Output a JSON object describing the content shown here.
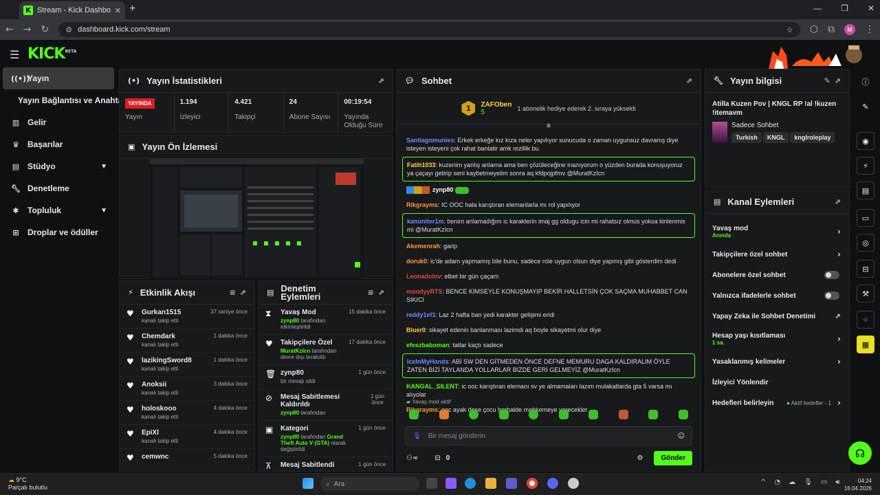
{
  "browser": {
    "tab_title": "Stream - Kick Dashboard",
    "tab_favicon": "K",
    "url": "dashboard.kick.com/stream",
    "profile_initial": "M"
  },
  "app": {
    "logo": "KICK",
    "logo_sup": "BETA"
  },
  "sidebar": {
    "items": [
      {
        "label": "Yayın",
        "icon": "broadcast-icon"
      },
      {
        "label": "Yayın Bağlantısı ve Anahtarı"
      },
      {
        "label": "Gelir",
        "icon": "chart-icon"
      },
      {
        "label": "Başarılar",
        "icon": "trophy-icon"
      },
      {
        "label": "Stüdyo",
        "icon": "studio-icon"
      },
      {
        "label": "Denetleme",
        "icon": "wrench-icon"
      },
      {
        "label": "Topluluk",
        "icon": "community-icon"
      },
      {
        "label": "Droplar ve ödüller",
        "icon": "gift-icon"
      }
    ]
  },
  "stats": {
    "title": "Yayın İstatistikleri",
    "live_badge": "YAYINDA",
    "cols": [
      {
        "value": "",
        "label": "Yayın"
      },
      {
        "value": "1.194",
        "label": "İzleyici"
      },
      {
        "value": "4.421",
        "label": "Takipçi"
      },
      {
        "value": "24",
        "label": "Abone Sayısı"
      },
      {
        "value": "00:19:54",
        "label": "Yayında Olduğu Süre"
      }
    ]
  },
  "preview": {
    "title": "Yayın Ön İzlemesi"
  },
  "activity": {
    "title": "Etkinlik Akışı",
    "items": [
      {
        "name": "Gurkan1515",
        "sub": "kanalı takip etti",
        "time": "37 saniye önce"
      },
      {
        "name": "Chemdark",
        "sub": "kanalı takip etti",
        "time": "1 dakika önce"
      },
      {
        "name": "lazikingSword8",
        "sub": "kanalı takip etti",
        "time": "1 dakika önce"
      },
      {
        "name": "Anoksii",
        "sub": "kanalı takip etti",
        "time": "3 dakika önce"
      },
      {
        "name": "holoskooo",
        "sub": "kanalı takip etti",
        "time": "4 dakika önce"
      },
      {
        "name": "EpiXl",
        "sub": "kanalı takip etti",
        "time": "4 dakika önce"
      },
      {
        "name": "cemwnc",
        "sub": "",
        "time": "5 dakika önce"
      }
    ]
  },
  "mods": {
    "title": "Denetim Eylemleri",
    "items": [
      {
        "name": "Yavaş Mod",
        "user": "zynp80",
        "sub": "tarafından etkinleştirildi",
        "time": "15 dakika önce"
      },
      {
        "name": "Takipçilere Özel",
        "user": "MuratKzIcn",
        "sub": "tarafından devre dışı bırakıldı",
        "time": "17 dakika önce"
      },
      {
        "name": "zynp80",
        "user": "",
        "sub": "bir mesajı sildi",
        "time": "1 gün önce"
      },
      {
        "name": "Mesaj Sabitlemesi Kaldırıldı",
        "user": "zynp80",
        "sub": "tarafından",
        "time": "1 gün önce"
      },
      {
        "name": "Kategori",
        "user": "zynp80",
        "sub": "tarafından",
        "extra": "Grand Theft Auto V (GTA)",
        "extra2": "olarak değiştirildi",
        "time": "1 gün önce"
      },
      {
        "name": "Mesaj Sabitlendi",
        "user": "",
        "sub": "",
        "time": "1 gün önce"
      }
    ]
  },
  "chat": {
    "title": "Sohbet",
    "pinned_user": "ZAFOben",
    "pinned_badge": "1",
    "pinned_count": "5",
    "pinned_text": "1 abonelik hediye ederek 2. sıraya yükseldi",
    "messages": [
      {
        "user": "Santiagomunies",
        "color": "#6b8cff",
        "text": "Erkek erkeğe kız kıza neler yapılıyor sunucuda o zaman uygunsuz davranış diye isteyen isteyeni çok rahat banlatir amk rezillik bu",
        "hl": false
      },
      {
        "user": "Fatih1033",
        "color": "#ffd23f",
        "text": "kuzenim yanlış anlama ama ben çözüleceğine inanıyorum o yüzden burada konuşuyoruz ya çaçayı getirip seni kaybetmeyelim sonra aq kfdpojpfmv @MuratKzIcn",
        "hl": true
      },
      {
        "user": "zynp80",
        "color": "#ffffff",
        "text": "",
        "hl": false,
        "badges": true
      },
      {
        "user": "Rikgrayms",
        "color": "#ff9a3c",
        "text": "IC OOC hala karıştıran elemanlarla mı rol yapılıyor",
        "hl": false
      },
      {
        "user": "kanuniter1m",
        "color": "#6b8cff",
        "text": "benim anlamadığım ic karakterin imaj gg oldugu icin mi rahatsız olmus yoksa kinlenmis mi @MuratKzIcn",
        "hl": true
      },
      {
        "user": "Akemenrah",
        "color": "#ff9a3c",
        "text": "garip",
        "hl": false
      },
      {
        "user": "doruk0",
        "color": "#ff9a3c",
        "text": "ic'de adam yapmamış bile bunu, sadece role uygun olsun diye yapmış gibi gösterdim dedi",
        "hl": false
      },
      {
        "user": "Leonadolov",
        "color": "#e0483b",
        "text": "elbet bir gün çaçam",
        "hl": false
      },
      {
        "user": "moodyyRTS",
        "color": "#e0483b",
        "text": "BENCE KİMSEYLE KONUŞMAYIP BEKİR HALLETSİN ÇOK SAÇMA MUHABBET CAN SIKICI",
        "hl": false
      },
      {
        "user": "reddy1ef1",
        "color": "#6b8cff",
        "text": "Laz 2 hafta ban yedi karakter gelişimi eridi",
        "hl": false
      },
      {
        "user": "Bluer0",
        "color": "#ffd23f",
        "text": "sikayet edenin banlanması lazimdi aq boyle sikayetmi olur diye",
        "hl": false
      },
      {
        "user": "efeszbaboman",
        "color": "#53fc18",
        "text": "tatlar kaçtı sadece",
        "hl": false
      },
      {
        "user": "IceInMyHands",
        "color": "#6b8cff",
        "text": "ABİ SW DEN GİTMEDEN ÖNCE DEFNE MEMURU DAGA KALDIRALIM ÖYLE ZATEN BİZİ TAYLANDA YOLLARLAR BİZDE GERİ GELMEYİZ @MuratKzIcn",
        "hl": true
      },
      {
        "user": "KANGAL_SILENT",
        "color": "#53fc18",
        "text": "ic ooc karıştıran elemanı sv ye almamaları lazım mulakatlarda gta 5 varsa mı alıyolar",
        "hl": false
      },
      {
        "user": "Rikgrayms",
        "color": "#ff9a3c",
        "text": "ooc ayak dese çocu herhalde mahkemeye verecekler",
        "hl": false
      }
    ],
    "slow_mode": "Yavaş mod aktif",
    "placeholder": "Bir mesaj gönderin",
    "counter": "0",
    "send": "Gönder"
  },
  "streaminfo": {
    "title": "Yayın bilgisi",
    "stream_title": "Atilla Kuzen Pov | KNGL RP !al !kuzen !itemavm",
    "category": "Sadece Sohbet",
    "tags": [
      "Turkish",
      "KNGL",
      "knglroleplay"
    ]
  },
  "channel_actions": {
    "title": "Kanal Eylemleri",
    "items": [
      {
        "label": "Yavaş mod",
        "sub": "Anında",
        "ctrl": "chevron"
      },
      {
        "label": "Takipçilere özel sohbet",
        "sub": "",
        "ctrl": "chevron"
      },
      {
        "label": "Abonelere özel sohbet",
        "sub": "",
        "ctrl": "toggle"
      },
      {
        "label": "Yalnızca ifadelerle sohbet",
        "sub": "",
        "ctrl": "toggle"
      },
      {
        "label": "Yapay Zeka ile Sohbet Denetimi",
        "sub": "",
        "ctrl": "external"
      },
      {
        "label": "Hesap yaşı kısıtlaması",
        "sub": "1 sa.",
        "ctrl": "chevron"
      },
      {
        "label": "Yasaklanmış kelimeler",
        "sub": "",
        "ctrl": "chevron"
      },
      {
        "label": "İzleyici Yönlendir",
        "sub": "",
        "ctrl": "none"
      },
      {
        "label": "Hedefleri belirleyin",
        "sub": "",
        "ctrl": "chevron",
        "note": "Aktif hedefler - 1"
      }
    ]
  },
  "taskbar": {
    "temp": "9°C",
    "weather": "Parçalı bulutlu",
    "search": "Ara",
    "time": "04:24",
    "date": "16.04.2026"
  },
  "colors": {
    "accent": "#53fc18",
    "live": "#e01b24"
  }
}
